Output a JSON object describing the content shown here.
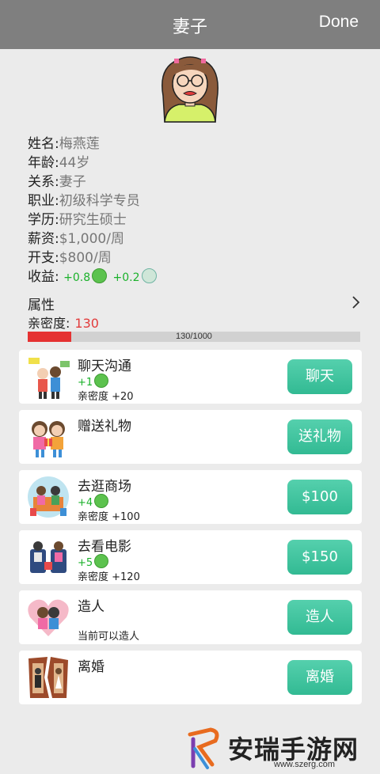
{
  "nav": {
    "title": "妻子",
    "done": "Done"
  },
  "profile": {
    "name_label": "姓名:",
    "name": "梅燕莲",
    "age_label": "年龄:",
    "age": "44岁",
    "relation_label": "关系:",
    "relation": "妻子",
    "job_label": "职业:",
    "job": "初级科学专员",
    "edu_label": "学历:",
    "edu": "研究生硕士",
    "salary_label": "薪资:",
    "salary": "$1,000/周",
    "expense_label": "开支:",
    "expense": "$800/周",
    "gain_label": "收益:",
    "gain1": "+0.8",
    "gain2": "+0.2"
  },
  "attributes": {
    "title": "属性",
    "intimacy_label": "亲密度:",
    "intimacy_value": "130",
    "bar_text": "130/1000",
    "bar_fraction": 0.13
  },
  "actions": [
    {
      "title": "聊天沟通",
      "gain": "+1",
      "sub": "亲密度 +20",
      "button": "聊天"
    },
    {
      "title": "赠送礼物",
      "gain": "",
      "sub": "",
      "button": "送礼物"
    },
    {
      "title": "去逛商场",
      "gain": "+4",
      "sub": "亲密度 +100",
      "button": "$100"
    },
    {
      "title": "去看电影",
      "gain": "+5",
      "sub": "亲密度 +120",
      "button": "$150"
    },
    {
      "title": "造人",
      "gain": "",
      "sub": "当前可以造人",
      "button": "造人"
    },
    {
      "title": "离婚",
      "gain": "",
      "sub": "",
      "button": "离婚"
    }
  ],
  "watermark": {
    "text": "安瑞手游网",
    "url": "www.szerg.com"
  },
  "colors": {
    "navbar": "#7f7f7f",
    "button": "#3cc29c",
    "bar_fill": "#e53232",
    "gain_green": "#1bb12b"
  }
}
